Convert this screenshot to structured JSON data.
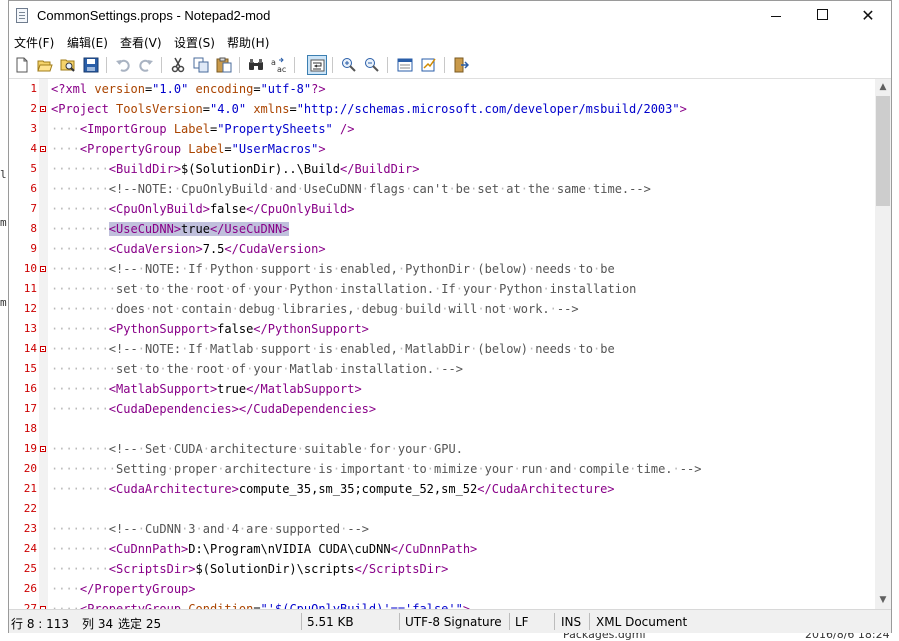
{
  "window": {
    "title": "CommonSettings.props - Notepad2-mod",
    "controls": {
      "minimize": "minimize",
      "maximize": "maximize",
      "close": "✕"
    }
  },
  "menu": [
    "文件(F)",
    "编辑(E)",
    "查看(V)",
    "设置(S)",
    "帮助(H)"
  ],
  "toolbar": {
    "buttons": [
      "new-icon",
      "open-icon",
      "browse-icon",
      "save-icon",
      "undo-icon",
      "redo-icon",
      "cut-icon",
      "copy-icon",
      "paste-icon",
      "find-icon",
      "replace-icon",
      "word-wrap-icon",
      "zoom-in-icon",
      "zoom-out-icon",
      "select-scheme-icon",
      "customize-scheme-icon",
      "exit-icon"
    ],
    "active": "word-wrap-icon"
  },
  "colors": {
    "tag": "#880088",
    "attribute": "#aa4400",
    "string": "#0000cc",
    "line_number": "#cc0000",
    "selection": "#c0c0dc"
  },
  "editor": {
    "lines": [
      {
        "n": "1",
        "fold": false,
        "ind": 0,
        "parts": [
          [
            "pi",
            "<?xml "
          ],
          [
            "attr",
            "version"
          ],
          [
            "txt",
            "="
          ],
          [
            "str",
            "\"1.0\""
          ],
          [
            "txt",
            " "
          ],
          [
            "attr",
            "encoding"
          ],
          [
            "txt",
            "="
          ],
          [
            "str",
            "\"utf-8\""
          ],
          [
            "pi",
            "?>"
          ]
        ]
      },
      {
        "n": "2",
        "fold": true,
        "ind": 0,
        "parts": [
          [
            "tag",
            "<Project "
          ],
          [
            "attr",
            "ToolsVersion"
          ],
          [
            "txt",
            "="
          ],
          [
            "str",
            "\"4.0\""
          ],
          [
            "txt",
            " "
          ],
          [
            "attr",
            "xmlns"
          ],
          [
            "txt",
            "="
          ],
          [
            "str",
            "\"http://schemas.microsoft.com/developer/msbuild/2003\""
          ],
          [
            "tag",
            ">"
          ]
        ]
      },
      {
        "n": "3",
        "fold": false,
        "ind": 4,
        "parts": [
          [
            "tag",
            "<ImportGroup "
          ],
          [
            "attr",
            "Label"
          ],
          [
            "txt",
            "="
          ],
          [
            "str",
            "\"PropertySheets\""
          ],
          [
            "txt",
            " "
          ],
          [
            "tag",
            "/>"
          ]
        ]
      },
      {
        "n": "4",
        "fold": true,
        "ind": 4,
        "parts": [
          [
            "tag",
            "<PropertyGroup "
          ],
          [
            "attr",
            "Label"
          ],
          [
            "txt",
            "="
          ],
          [
            "str",
            "\"UserMacros\""
          ],
          [
            "tag",
            ">"
          ]
        ]
      },
      {
        "n": "5",
        "fold": false,
        "ind": 8,
        "parts": [
          [
            "tag",
            "<BuildDir>"
          ],
          [
            "txt",
            "$(SolutionDir)..\\Build"
          ],
          [
            "tag",
            "</BuildDir>"
          ]
        ]
      },
      {
        "n": "6",
        "fold": false,
        "ind": 8,
        "parts": [
          [
            "comment",
            "<!--NOTE: CpuOnlyBuild and UseCuDNN flags can't be set at the same time.-->"
          ]
        ]
      },
      {
        "n": "7",
        "fold": false,
        "ind": 8,
        "parts": [
          [
            "tag",
            "<CpuOnlyBuild>"
          ],
          [
            "txt",
            "false"
          ],
          [
            "tag",
            "</CpuOnlyBuild>"
          ]
        ]
      },
      {
        "n": "8",
        "fold": false,
        "ind": 8,
        "sel": true,
        "parts": [
          [
            "tag",
            "<UseCuDNN>"
          ],
          [
            "txt",
            "true"
          ],
          [
            "tag",
            "</UseCuDNN>"
          ]
        ]
      },
      {
        "n": "9",
        "fold": false,
        "ind": 8,
        "parts": [
          [
            "tag",
            "<CudaVersion>"
          ],
          [
            "txt",
            "7.5"
          ],
          [
            "tag",
            "</CudaVersion>"
          ]
        ]
      },
      {
        "n": "10",
        "fold": true,
        "ind": 8,
        "parts": [
          [
            "comment",
            "<!-- NOTE: If Python support is enabled, PythonDir (below) needs to be"
          ]
        ]
      },
      {
        "n": "11",
        "fold": false,
        "ind": 9,
        "parts": [
          [
            "comment",
            "set to the root of your Python installation. If your Python installation"
          ]
        ]
      },
      {
        "n": "12",
        "fold": false,
        "ind": 9,
        "parts": [
          [
            "comment",
            "does not contain debug libraries, debug build will not work. -->"
          ]
        ]
      },
      {
        "n": "13",
        "fold": false,
        "ind": 8,
        "parts": [
          [
            "tag",
            "<PythonSupport>"
          ],
          [
            "txt",
            "false"
          ],
          [
            "tag",
            "</PythonSupport>"
          ]
        ]
      },
      {
        "n": "14",
        "fold": true,
        "ind": 8,
        "parts": [
          [
            "comment",
            "<!-- NOTE: If Matlab support is enabled, MatlabDir (below) needs to be"
          ]
        ]
      },
      {
        "n": "15",
        "fold": false,
        "ind": 9,
        "parts": [
          [
            "comment",
            "set to the root of your Matlab installation. -->"
          ]
        ]
      },
      {
        "n": "16",
        "fold": false,
        "ind": 8,
        "parts": [
          [
            "tag",
            "<MatlabSupport>"
          ],
          [
            "txt",
            "true"
          ],
          [
            "tag",
            "</MatlabSupport>"
          ]
        ]
      },
      {
        "n": "17",
        "fold": false,
        "ind": 8,
        "parts": [
          [
            "tag",
            "<CudaDependencies></CudaDependencies>"
          ]
        ]
      },
      {
        "n": "18",
        "fold": false,
        "ind": 0,
        "parts": []
      },
      {
        "n": "19",
        "fold": true,
        "ind": 8,
        "parts": [
          [
            "comment",
            "<!-- Set CUDA architecture suitable for your GPU."
          ]
        ]
      },
      {
        "n": "20",
        "fold": false,
        "ind": 9,
        "parts": [
          [
            "comment",
            "Setting proper architecture is important to mimize your run and compile time. -->"
          ]
        ]
      },
      {
        "n": "21",
        "fold": false,
        "ind": 8,
        "parts": [
          [
            "tag",
            "<CudaArchitecture>"
          ],
          [
            "txt",
            "compute_35,sm_35;compute_52,sm_52"
          ],
          [
            "tag",
            "</CudaArchitecture>"
          ]
        ]
      },
      {
        "n": "22",
        "fold": false,
        "ind": 0,
        "parts": []
      },
      {
        "n": "23",
        "fold": false,
        "ind": 8,
        "parts": [
          [
            "comment",
            "<!-- CuDNN 3 and 4 are supported -->"
          ]
        ]
      },
      {
        "n": "24",
        "fold": false,
        "ind": 8,
        "parts": [
          [
            "tag",
            "<CuDnnPath>"
          ],
          [
            "txt",
            "D:\\Program\\nVIDIA CUDA\\cuDNN"
          ],
          [
            "tag",
            "</CuDnnPath>"
          ]
        ]
      },
      {
        "n": "25",
        "fold": false,
        "ind": 8,
        "parts": [
          [
            "tag",
            "<ScriptsDir>"
          ],
          [
            "txt",
            "$(SolutionDir)\\scripts"
          ],
          [
            "tag",
            "</ScriptsDir>"
          ]
        ]
      },
      {
        "n": "26",
        "fold": false,
        "ind": 4,
        "parts": [
          [
            "tag",
            "</PropertyGroup>"
          ]
        ]
      },
      {
        "n": "27",
        "fold": true,
        "ind": 4,
        "parts": [
          [
            "tag",
            "<PropertyGroup "
          ],
          [
            "attr",
            "Condition"
          ],
          [
            "txt",
            "="
          ],
          [
            "str",
            "\"'$(CpuOnlyBuild)'=='false'\""
          ],
          [
            "tag",
            ">"
          ]
        ]
      }
    ]
  },
  "status": {
    "position": "行 8 : 113",
    "column": "列 34",
    "selected": "选定 25",
    "size": "5.51 KB",
    "encoding": "UTF-8 Signature",
    "eol": "LF",
    "ins": "INS",
    "scheme": "XML Document"
  },
  "background": {
    "bottom_file": "Packages.dgml",
    "bottom_date": "2016/8/6 18:24"
  }
}
